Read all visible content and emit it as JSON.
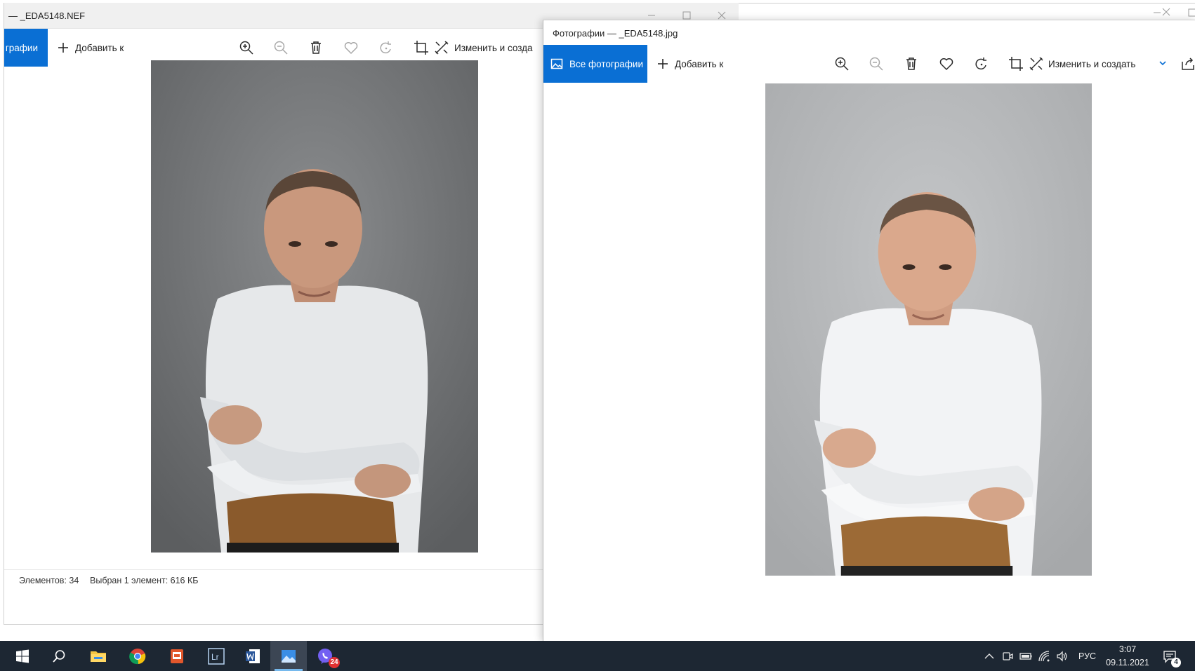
{
  "left_window": {
    "title": "— _EDA5148.NEF",
    "nav_label": "графии",
    "add_label": "Добавить к",
    "edit_label": "Изменить и созда",
    "status_items_count": "Элементов: 34",
    "status_selected": "Выбран 1 элемент: 616 КБ"
  },
  "right_window": {
    "title": "Фотографии — _EDA5148.jpg",
    "nav_label": "Все фотографии",
    "add_label": "Добавить к",
    "edit_label": "Изменить и создать"
  },
  "taskbar": {
    "apps": [
      "start",
      "search",
      "file-explorer",
      "chrome",
      "document-app",
      "lightroom",
      "word",
      "photos",
      "viber"
    ],
    "viber_badge": "24",
    "language": "РУС",
    "time": "3:07",
    "date": "09.11.2021",
    "notification_count": "4"
  },
  "colors": {
    "accent": "#0a6fd4",
    "taskbar_bg": "#1d2733",
    "photo_bg_raw": "#6f7173",
    "photo_bg_jpg": "#b9bbbd"
  }
}
